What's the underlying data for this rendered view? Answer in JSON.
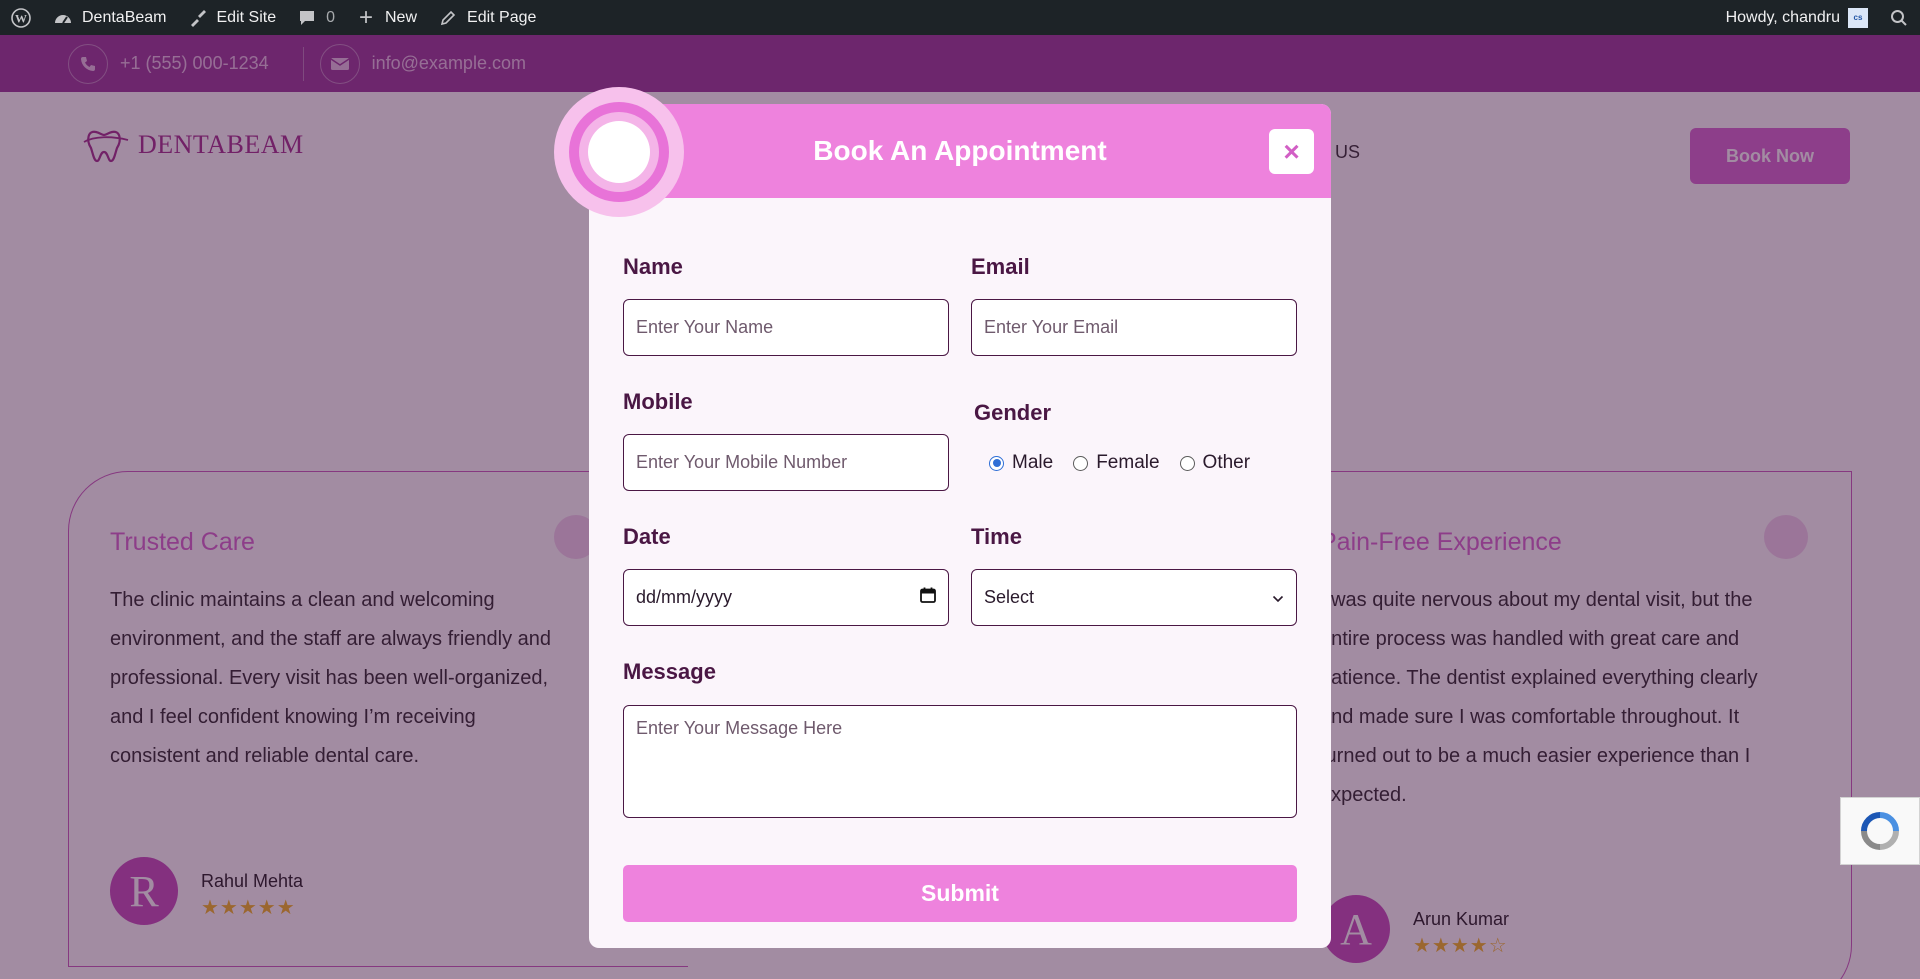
{
  "adminbar": {
    "site_name": "DentaBeam",
    "edit_site": "Edit Site",
    "comments_count": "0",
    "new": "New",
    "edit_page": "Edit Page",
    "howdy": "Howdy, chandru",
    "avatar_initials": "cs"
  },
  "topbar": {
    "phone": "+1 (555) 000-1234",
    "email": "info@example.com"
  },
  "header": {
    "logo_text": "DENTABEAM",
    "nav_fragment": "US",
    "book_now": "Book Now"
  },
  "testimonials": [
    {
      "title": "Trusted Care",
      "lines": [
        "The clinic maintains a clean and welcoming",
        "environment, and the staff are always friendly and",
        "professional. Every visit has been well-organized,",
        "and I feel confident knowing I’m receiving",
        "consistent and reliable dental care."
      ],
      "initial": "R",
      "name": "Rahul Mehta",
      "stars": "★★★★★"
    },
    {
      "title": "Pain-Free Experience",
      "lines": [
        "I was quite nervous about my dental visit, but the",
        "entire process was handled with great care and",
        "patience. The dentist explained everything clearly",
        "and made sure I was comfortable throughout. It",
        "turned out to be a much easier experience than I",
        "expected."
      ],
      "initial": "A",
      "name": "Arun Kumar",
      "stars": "★★★★☆"
    }
  ],
  "modal": {
    "title": "Book An Appointment",
    "close": "×",
    "name_label": "Name",
    "name_placeholder": "Enter Your Name",
    "email_label": "Email",
    "email_placeholder": "Enter Your Email",
    "mobile_label": "Mobile",
    "mobile_placeholder": "Enter Your Mobile Number",
    "gender_label": "Gender",
    "gender_options": [
      "Male",
      "Female",
      "Other"
    ],
    "gender_selected": "Male",
    "date_label": "Date",
    "date_value": "dd/mm/yyyy",
    "time_label": "Time",
    "time_value": "Select",
    "message_label": "Message",
    "message_placeholder": "Enter Your Message Here",
    "submit": "Submit"
  },
  "colors": {
    "accent": "#ee82dd",
    "brand_dark": "#4a1744",
    "overlay": "#3c0f3c"
  }
}
